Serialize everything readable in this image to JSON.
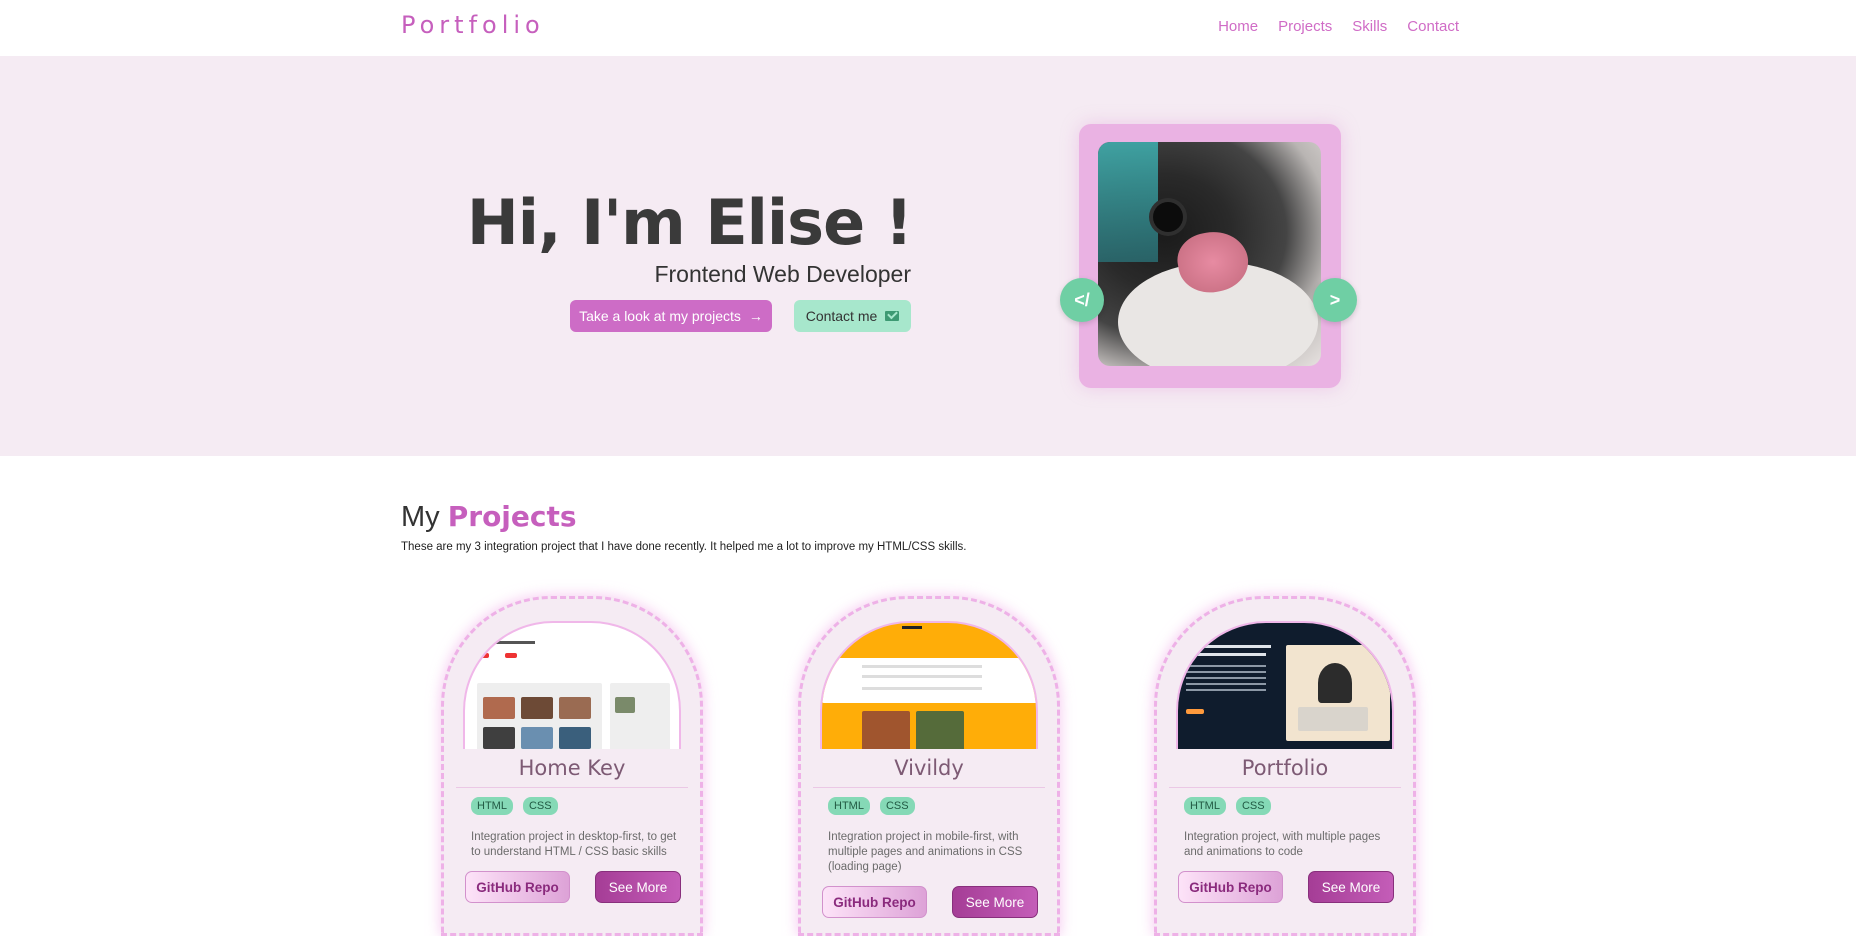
{
  "nav": {
    "logo": "Portfolio",
    "links": [
      "Home",
      "Projects",
      "Skills",
      "Contact"
    ]
  },
  "hero": {
    "title": "Hi, I'm Elise !",
    "subtitle": "Frontend Web Developer",
    "projects_button": "Take a look at my projects",
    "contact_button": "Contact me",
    "code_badge": "</",
    "arrow_badge": ">"
  },
  "projects": {
    "title_prefix": "My",
    "title_accent": "Projects",
    "description": "These are my 3 integration project that I have done recently. It helped me a lot to improve my HTML/CSS skills.",
    "cards": [
      {
        "title": "Home Key",
        "tags": [
          "HTML",
          "CSS"
        ],
        "description": "Integration project in desktop-first, to get to understand HTML / CSS basic skills",
        "repo_label": "GitHub Repo",
        "more_label": "See More"
      },
      {
        "title": "Vivildy",
        "tags": [
          "HTML",
          "CSS"
        ],
        "description": "Integration project in mobile-first, with multiple pages and animations in CSS (loading page)",
        "repo_label": "GitHub Repo",
        "more_label": "See More"
      },
      {
        "title": "Portfolio",
        "tags": [
          "HTML",
          "CSS"
        ],
        "description": "Integration project, with multiple pages and animations to code",
        "repo_label": "GitHub Repo",
        "more_label": "See More"
      }
    ]
  },
  "colors": {
    "accent": "#c65fbd",
    "mint": "#a7e7cc",
    "hero_bg": "#f5ebf3"
  }
}
